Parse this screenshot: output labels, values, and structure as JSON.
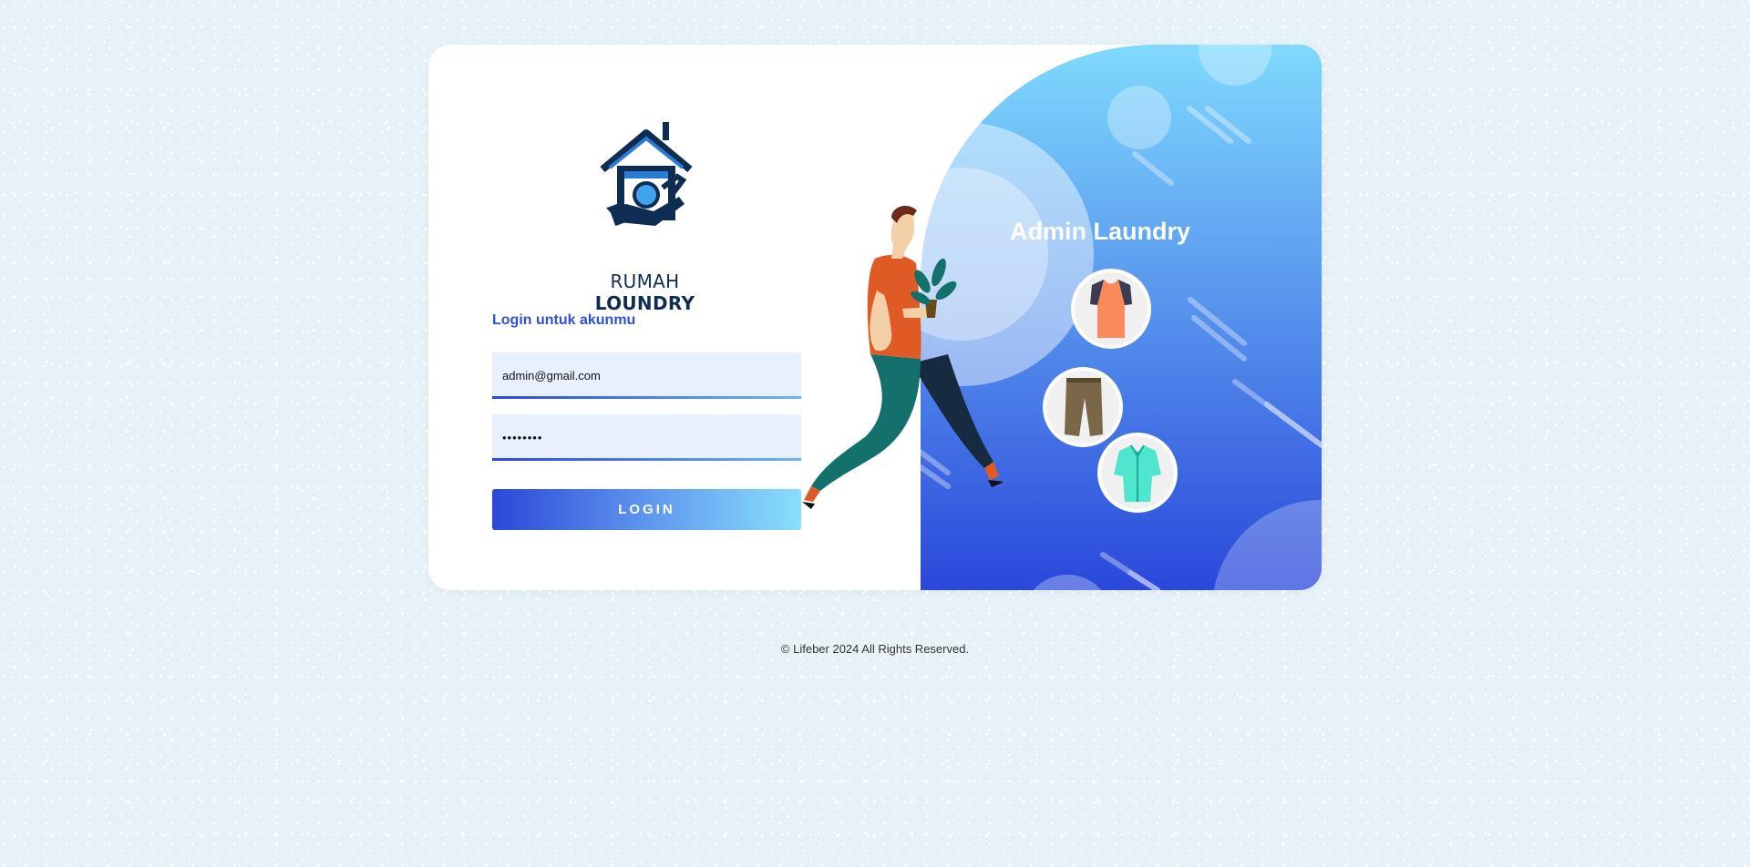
{
  "brand": {
    "name_light": "RUMAH ",
    "name_bold": "LOUNDRY",
    "logo_icon": "house-washing-machine-icon"
  },
  "login": {
    "heading": "Login untuk akunmu",
    "email_value": "admin@gmail.com",
    "password_value": "password",
    "button_label": "LOGIN"
  },
  "hero": {
    "title": "Admin Laundry",
    "illustration": "man-carrying-plant",
    "items": [
      "tshirt-icon",
      "pants-icon",
      "shirt-icon"
    ]
  },
  "footer": {
    "copyright": "© Lifeber 2024 All Rights Reserved."
  },
  "colors": {
    "accent": "#2f4fd6",
    "gradient_start": "#2b48d8",
    "gradient_end": "#88e0fb",
    "page_bg": "#e7f1f8"
  }
}
